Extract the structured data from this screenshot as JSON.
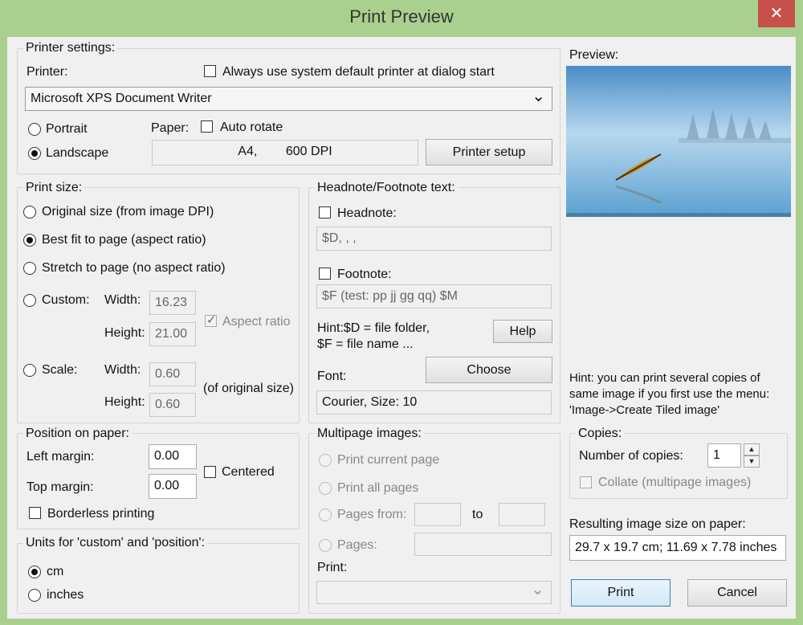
{
  "window": {
    "title": "Print Preview",
    "close_glyph": "✕"
  },
  "printer_settings": {
    "group_label": "Printer settings:",
    "printer_label": "Printer:",
    "always_default_label": "Always use system default printer at dialog start",
    "always_default_checked": false,
    "printer_value": "Microsoft XPS Document Writer",
    "dropdown_glyph": "⌄",
    "portrait_label": "Portrait",
    "landscape_label": "Landscape",
    "orientation": "Landscape",
    "paper_label": "Paper:",
    "auto_rotate_label": "Auto rotate",
    "auto_rotate_checked": false,
    "paper_value": "A4,        600 DPI",
    "printer_setup_label": "Printer setup"
  },
  "print_size": {
    "group_label": "Print size:",
    "original_label": "Original size (from image DPI)",
    "best_fit_label": "Best fit to page (aspect ratio)",
    "stretch_label": "Stretch to page (no aspect ratio)",
    "custom_label": "Custom:",
    "scale_label": "Scale:",
    "selected": "Best fit to page (aspect ratio)",
    "width_label": "Width:",
    "height_label": "Height:",
    "custom_width": "16.23",
    "custom_height": "21.00",
    "aspect_ratio_label": "Aspect ratio",
    "aspect_ratio_checked": true,
    "scale_width": "0.60",
    "scale_height": "0.60",
    "of_original_label": "(of original size)"
  },
  "headnote": {
    "group_label": "Headnote/Footnote text:",
    "headnote_label": "Headnote:",
    "headnote_value": "$D, , ,",
    "footnote_label": "Footnote:",
    "footnote_value": "$F (test: pp jj gg qq) $M",
    "hint_line1": "Hint:$D = file folder,",
    "hint_line2": "$F = file name ...",
    "help_label": "Help",
    "font_label": "Font:",
    "choose_label": "Choose",
    "font_value": "Courier, Size: 10"
  },
  "position": {
    "group_label": "Position on paper:",
    "left_margin_label": "Left margin:",
    "left_margin_value": "0.00",
    "top_margin_label": "Top margin:",
    "top_margin_value": "0.00",
    "centered_label": "Centered",
    "borderless_label": "Borderless printing"
  },
  "units": {
    "group_label": "Units for 'custom' and 'position':",
    "cm_label": "cm",
    "inches_label": "inches",
    "selected": "cm"
  },
  "multipage": {
    "group_label": "Multipage images:",
    "current_label": "Print current page",
    "all_label": "Print all pages",
    "from_label": "Pages from:",
    "to_label": "to",
    "pages_label": "Pages:",
    "print_label": "Print:",
    "dropdown_glyph": "⌄"
  },
  "preview": {
    "label": "Preview:",
    "image_icon": "lake-canoe-photo",
    "hint": [
      "Hint: you can print several copies of",
      "same image if you first use the menu:",
      "'Image->Create Tiled image'"
    ]
  },
  "copies": {
    "group_label": "Copies:",
    "number_label": "Number of copies:",
    "number_value": "1",
    "spin_up": "▲",
    "spin_down": "▼",
    "collate_label": "Collate (multipage images)"
  },
  "result": {
    "label": "Resulting image size on paper:",
    "value": "29.7 x 19.7 cm; 11.69 x 7.78 inches"
  },
  "buttons": {
    "print_label": "Print",
    "cancel_label": "Cancel"
  }
}
